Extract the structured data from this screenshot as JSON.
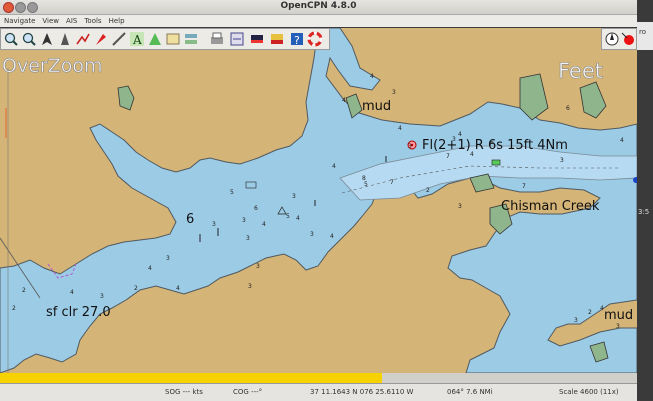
{
  "window": {
    "title": "OpenCPN 4.8.0"
  },
  "menu": {
    "items": [
      "Navigate",
      "View",
      "AIS",
      "Tools",
      "Help"
    ]
  },
  "toolbar": {
    "buttons": [
      "zoom-in",
      "zoom-out",
      "north-up",
      "auto-follow",
      "route",
      "waypoint",
      "measure",
      "text",
      "ais",
      "tides",
      "currents",
      "print",
      "settings",
      "color-scheme",
      "mob",
      "help",
      "ais-target-list"
    ]
  },
  "overlay": {
    "left": "OverZoom",
    "right": "Feet"
  },
  "chart_labels": {
    "mud_1": "mud",
    "light": "Fl(2+1) R 6s 15ft 4Nm",
    "creek": "Chisman Creek",
    "depth_6": "6",
    "bottom": "sf clr 27.0",
    "mud_2": "mud"
  },
  "soundings": [
    "4",
    "3",
    "4",
    "4",
    "3",
    "3",
    "5",
    "8",
    "4",
    "7",
    "4",
    "7",
    "6",
    "4",
    "6",
    "4",
    "3",
    "6",
    "5",
    "3",
    "4",
    "3",
    "3",
    "3",
    "4",
    "4",
    "5",
    "7",
    "2",
    "3",
    "4",
    "3",
    "2",
    "4",
    "3",
    "2",
    "3",
    "4",
    "3",
    "3",
    "3",
    "2",
    "4",
    "3",
    "2"
  ],
  "right_fragments": {
    "top": "ro",
    "mid": "3:5"
  },
  "status": {
    "sog": "SOG --- kts",
    "cog": "COG ---°",
    "position": "37 11.1643 N  076 25.6110 W",
    "bearing": "064°  7.6 NMi",
    "scale": "Scale 4600 (11x)"
  },
  "progress_fraction": 0.6,
  "colors": {
    "water": "#9ccbe6",
    "deep_water": "#b5daf1",
    "land": "#d5b477",
    "marsh": "#8fb58c",
    "progress": "#f6d200"
  }
}
